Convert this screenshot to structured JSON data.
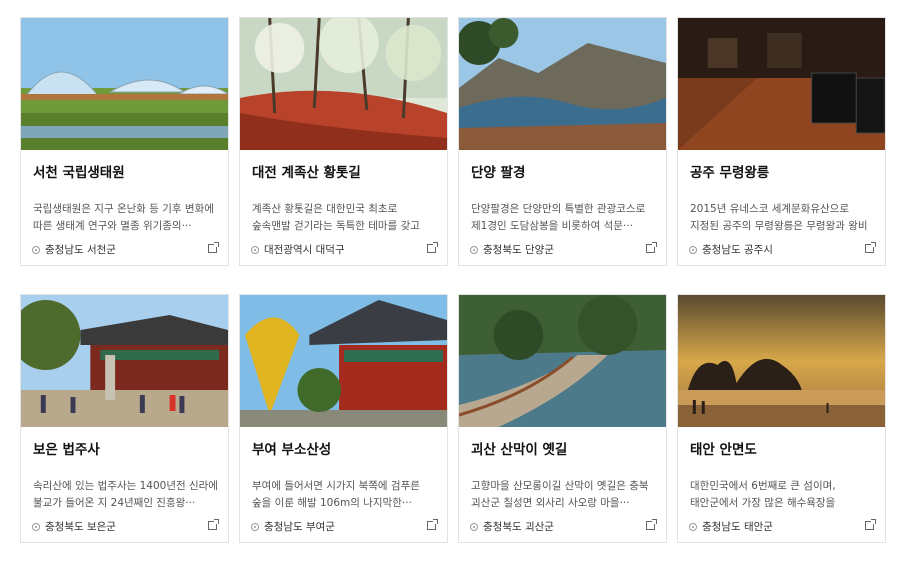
{
  "cards": [
    {
      "title": "서천 국립생태원",
      "desc": "국립생태원은 지구 온난화 등 기후 변화에 따른 생태계 연구와 멸종 위기종의···",
      "location": "충청남도 서천군"
    },
    {
      "title": "대전 계족산 황톳길",
      "desc": "계족산 황톳길은 대한민국 최초로 숲속맨발 걷기라는 독특한 테마를 갖고 산길···",
      "location": "대전광역시 대덕구"
    },
    {
      "title": "단양 팔경",
      "desc": "단양팔경은 단양만의 특별한 관광코스로 제1경인 도담삼봉을 비롯하여 석문···",
      "location": "충청북도 단양군"
    },
    {
      "title": "공주 무령왕릉",
      "desc": "2015년 유네스코 세계문화유산으로 지정된 공주의 무령왕릉은 무령왕과 왕비···",
      "location": "충청남도 공주시"
    },
    {
      "title": "보은 법주사",
      "desc": "속리산에 있는 법주사는 1400년전 신라에 불교가 들어온 지 24년째인 진흥왕···",
      "location": "충청북도 보은군"
    },
    {
      "title": "부여 부소산성",
      "desc": "부여에 들어서면 시가지 북쪽에 검푸른 숲을 이룬 해발 106m의 나지막한···",
      "location": "충청남도 부여군"
    },
    {
      "title": "괴산 산막이 옛길",
      "desc": "고향마을 산모롱이길 산막이 옛길은 충북 괴산군 칠성면 외사리 사오랑 마을···",
      "location": "충청북도 괴산군"
    },
    {
      "title": "태안 안면도",
      "desc": "대한민국에서 6번째로 큰 섬이며, 태안군에서 가장 많은 해수욕장을 보유하고···",
      "location": "충청남도 태안군"
    }
  ]
}
